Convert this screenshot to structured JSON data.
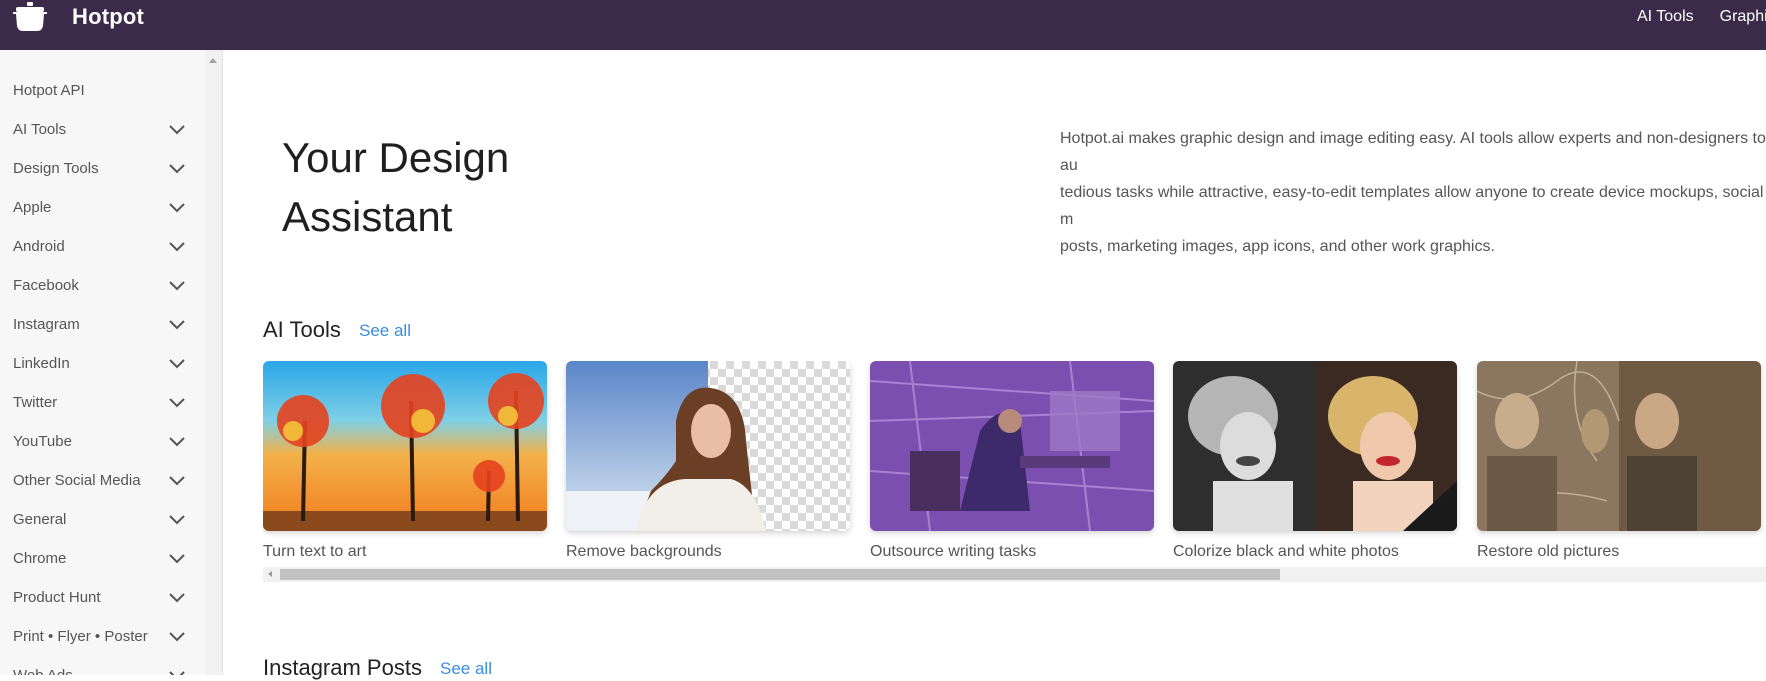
{
  "header": {
    "brand": "Hotpot",
    "nav": [
      "AI Tools",
      "Graphi"
    ]
  },
  "sidebar": {
    "items": [
      {
        "label": "Hotpot API",
        "expandable": false
      },
      {
        "label": "AI Tools",
        "expandable": true
      },
      {
        "label": "Design Tools",
        "expandable": true
      },
      {
        "label": "Apple",
        "expandable": true
      },
      {
        "label": "Android",
        "expandable": true
      },
      {
        "label": "Facebook",
        "expandable": true
      },
      {
        "label": "Instagram",
        "expandable": true
      },
      {
        "label": "LinkedIn",
        "expandable": true
      },
      {
        "label": "Twitter",
        "expandable": true
      },
      {
        "label": "YouTube",
        "expandable": true
      },
      {
        "label": "Other Social Media",
        "expandable": true
      },
      {
        "label": "General",
        "expandable": true
      },
      {
        "label": "Chrome",
        "expandable": true
      },
      {
        "label": "Product Hunt",
        "expandable": true
      },
      {
        "label": "Print • Flyer • Poster",
        "expandable": true
      },
      {
        "label": "Web Ads",
        "expandable": true
      }
    ]
  },
  "hero": {
    "title": "Your Design Assistant",
    "description": "Hotpot.ai makes graphic design and image editing easy. AI tools allow experts and non-designers to au\ntedious tasks while attractive, easy-to-edit templates allow anyone to create device mockups, social m\nposts, marketing images, app icons, and other work graphics."
  },
  "sections": [
    {
      "title": "AI Tools",
      "see_all": "See all",
      "cards": [
        {
          "caption": "Turn text to art"
        },
        {
          "caption": "Remove backgrounds"
        },
        {
          "caption": "Outsource writing tasks"
        },
        {
          "caption": "Colorize black and white photos"
        },
        {
          "caption": "Restore old pictures"
        }
      ]
    },
    {
      "title": "Instagram Posts",
      "see_all": "See all"
    }
  ],
  "colors": {
    "header_bg": "#3c2a4a",
    "link": "#3a8dde",
    "sidebar_bg": "#f7f7f7"
  },
  "icons": {
    "brand": "hotpot-icon",
    "expand": "chevron-down-icon"
  }
}
